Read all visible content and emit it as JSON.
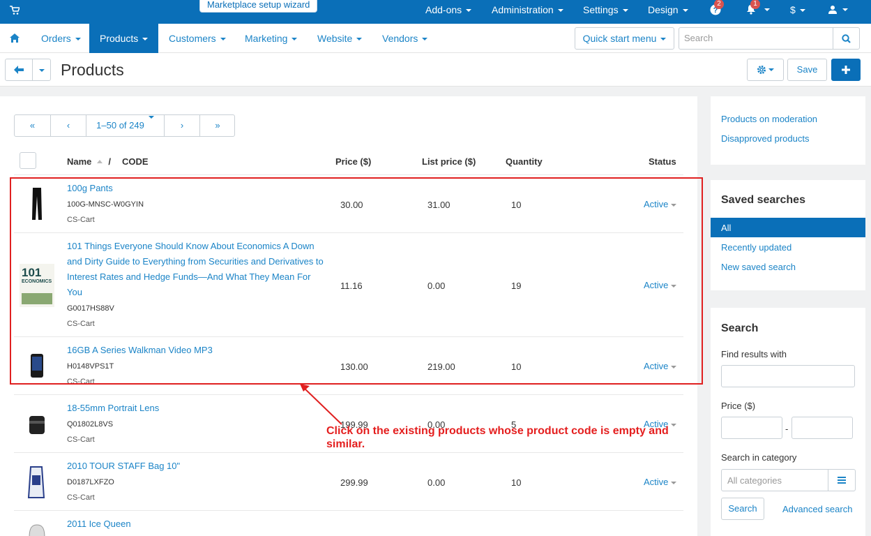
{
  "topbar": {
    "wizard_label": "Marketplace setup wizard",
    "menus": [
      "Add-ons",
      "Administration",
      "Settings",
      "Design"
    ],
    "help_badge": "2",
    "bell_badge": "1",
    "currency": "$"
  },
  "nav": {
    "items": [
      "Orders",
      "Products",
      "Customers",
      "Marketing",
      "Website",
      "Vendors"
    ],
    "active": "Products",
    "quick_start": "Quick start menu",
    "search_placeholder": "Search"
  },
  "page": {
    "title": "Products",
    "save_label": "Save"
  },
  "pager": {
    "first": "«",
    "prev": "‹",
    "range": "1–50 of 249",
    "next": "›",
    "last": "»"
  },
  "table": {
    "headers": {
      "name": "Name",
      "separator": "/",
      "code": "CODE",
      "price": "Price ($)",
      "list_price": "List price ($)",
      "quantity": "Quantity",
      "status": "Status"
    },
    "rows": [
      {
        "name": "100g Pants",
        "code": "100G-MNSC-W0GYIN",
        "vendor": "CS-Cart",
        "price": "30.00",
        "list_price": "31.00",
        "quantity": "10",
        "status": "Active"
      },
      {
        "name": "101 Things Everyone Should Know About Economics A Down and Dirty Guide to Everything from Securities and Derivatives to Interest Rates and Hedge Funds—And What They Mean For You",
        "code": "G0017HS88V",
        "vendor": "CS-Cart",
        "price": "11.16",
        "list_price": "0.00",
        "quantity": "19",
        "status": "Active"
      },
      {
        "name": "16GB A Series Walkman Video MP3",
        "code": "H0148VPS1T",
        "vendor": "CS-Cart",
        "price": "130.00",
        "list_price": "219.00",
        "quantity": "10",
        "status": "Active"
      },
      {
        "name": "18-55mm Portrait Lens",
        "code": "Q01802L8VS",
        "vendor": "CS-Cart",
        "price": "199.99",
        "list_price": "0.00",
        "quantity": "5",
        "status": "Active"
      },
      {
        "name": "2010 TOUR STAFF Bag 10\"",
        "code": "D0187LXFZO",
        "vendor": "CS-Cart",
        "price": "299.99",
        "list_price": "0.00",
        "quantity": "10",
        "status": "Active"
      },
      {
        "name": "2011 Ice Queen",
        "code": "",
        "vendor": "",
        "price": "",
        "list_price": "",
        "quantity": "",
        "status": ""
      }
    ]
  },
  "sidebar": {
    "links": [
      "Products on moderation",
      "Disapproved products"
    ],
    "saved_searches_title": "Saved searches",
    "saved_searches": [
      "All",
      "Recently updated",
      "New saved search"
    ],
    "search_title": "Search",
    "find_label": "Find results with",
    "price_label": "Price ($)",
    "price_dash": "-",
    "category_label": "Search in category",
    "category_placeholder": "All categories",
    "search_button": "Search",
    "advanced_link": "Advanced search"
  },
  "annotation": {
    "text": "Click on the existing products whose product code is empty and similar.",
    "color": "#e41e1e"
  },
  "colors": {
    "brand": "#0a6fb8",
    "link": "#1b84c7",
    "badge": "#d9534f"
  }
}
